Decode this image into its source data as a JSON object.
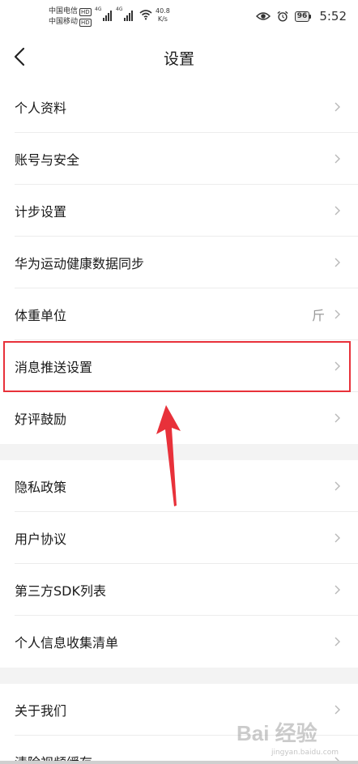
{
  "status_bar": {
    "carrier1": "中国电信",
    "carrier2": "中国移动",
    "hd": "HD",
    "net_type": "4G",
    "speed_value": "40.8",
    "speed_unit": "K/s",
    "battery": "96",
    "time": "5:52"
  },
  "nav": {
    "title": "设置"
  },
  "groups": [
    [
      {
        "label": "个人资料"
      },
      {
        "label": "账号与安全"
      },
      {
        "label": "计步设置"
      },
      {
        "label": "华为运动健康数据同步"
      },
      {
        "label": "体重单位",
        "value": "斤"
      },
      {
        "label": "消息推送设置",
        "highlighted": true
      },
      {
        "label": "好评鼓励"
      }
    ],
    [
      {
        "label": "隐私政策"
      },
      {
        "label": "用户协议"
      },
      {
        "label": "第三方SDK列表"
      },
      {
        "label": "个人信息收集清单"
      }
    ],
    [
      {
        "label": "关于我们"
      },
      {
        "label": "清除视频缓存"
      }
    ]
  ],
  "annotation": {
    "color": "#e8313a"
  },
  "watermark": {
    "text": "Bai 经验",
    "url": "jingyan.baidu.com"
  }
}
